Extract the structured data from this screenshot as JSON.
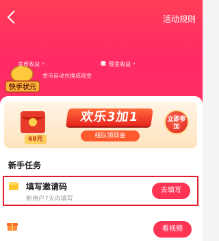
{
  "header": {
    "rules_label": "活动规则",
    "coins_label": "金币收益",
    "cash_label": "现金收益",
    "auto_note": "金币自动兑换成现金",
    "logo_text": "快手状元"
  },
  "banner": {
    "title": "欢乐3加1",
    "subtitle": "组队领现金",
    "price": "68元",
    "join": "立即参加"
  },
  "tasks_section": {
    "title": "新手任务",
    "items": [
      {
        "title": "填写邀请码",
        "desc": "新用户7天内填写",
        "button": "去填写"
      },
      {
        "title": "",
        "desc": "",
        "button": "看视频"
      }
    ]
  },
  "colors": {
    "accent": "#ff3353",
    "header": "#ff2f63",
    "highlight": "#e01b2b"
  }
}
